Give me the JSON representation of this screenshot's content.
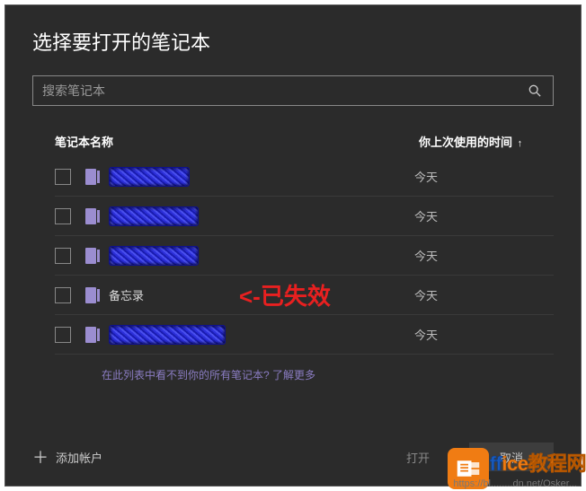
{
  "dialog": {
    "title": "选择要打开的笔记本"
  },
  "search": {
    "placeholder": "搜索笔记本"
  },
  "headers": {
    "name": "笔记本名称",
    "time": "你上次使用的时间",
    "sort_arrow": "↑"
  },
  "rows": [
    {
      "name": "",
      "time": "今天",
      "redacted": true,
      "redact_class": "r1"
    },
    {
      "name": "",
      "time": "今天",
      "redacted": true,
      "redact_class": "r2"
    },
    {
      "name": "",
      "time": "今天",
      "redacted": true,
      "redact_class": "r3"
    },
    {
      "name": "备忘录",
      "time": "今天",
      "redacted": false
    },
    {
      "name": "",
      "time": "今天",
      "redacted": true,
      "redact_class": "r5"
    }
  ],
  "annotation": "<-已失效",
  "footer_link": "在此列表中看不到你的所有笔记本? 了解更多",
  "bottom": {
    "add_account": "添加帐户",
    "open": "打开",
    "cancel": "取消"
  },
  "watermark": {
    "text_part1": "ff",
    "text_part2": "ice",
    "text_part3": "教程网",
    "url": "https://bl........dn.net/Osker..."
  }
}
